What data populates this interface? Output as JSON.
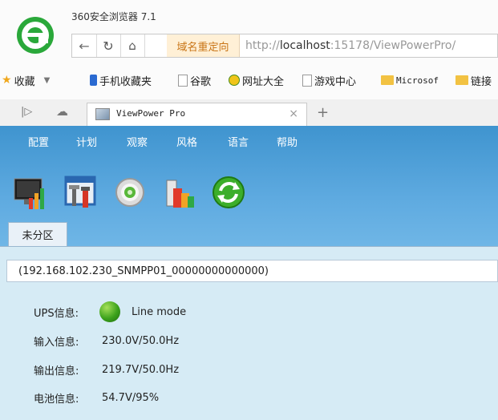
{
  "browser": {
    "title": "360安全浏览器 7.1",
    "redirect_label": "域名重定向",
    "url_prefix": "http://",
    "url_host": "localhost",
    "url_rest": ":15178/ViewPowerPro/"
  },
  "bookmarks": [
    {
      "label": "收藏",
      "icon": "star-plus-icon"
    },
    {
      "label": "手机收藏夹",
      "icon": "phone-icon"
    },
    {
      "label": "谷歌",
      "icon": "page-icon"
    },
    {
      "label": "网址大全",
      "icon": "globe-icon"
    },
    {
      "label": "游戏中心",
      "icon": "page-icon"
    },
    {
      "label": "Microsof",
      "icon": "folder-icon"
    },
    {
      "label": "链接",
      "icon": "folder-icon"
    }
  ],
  "tab": {
    "title": "ViewPower Pro",
    "new_tab": "+",
    "close": "×"
  },
  "menu": [
    "配置",
    "计划",
    "观察",
    "风格",
    "语言",
    "帮助"
  ],
  "zone_tab": "未分区",
  "device": {
    "name": "(192.168.102.230_SNMPP01_00000000000000)"
  },
  "info": {
    "ups_label": "UPS信息:",
    "ups_value": "Line mode",
    "input_label": "输入信息:",
    "input_value": "230.0V/50.0Hz",
    "output_label": "输出信息:",
    "output_value": "219.7V/50.0Hz",
    "battery_label": "电池信息:",
    "battery_value": "54.7V/95%"
  },
  "colors": {
    "header_blue": "#3f94cf",
    "content_bg": "#d6ebf5",
    "status_green": "#3ca21c"
  }
}
